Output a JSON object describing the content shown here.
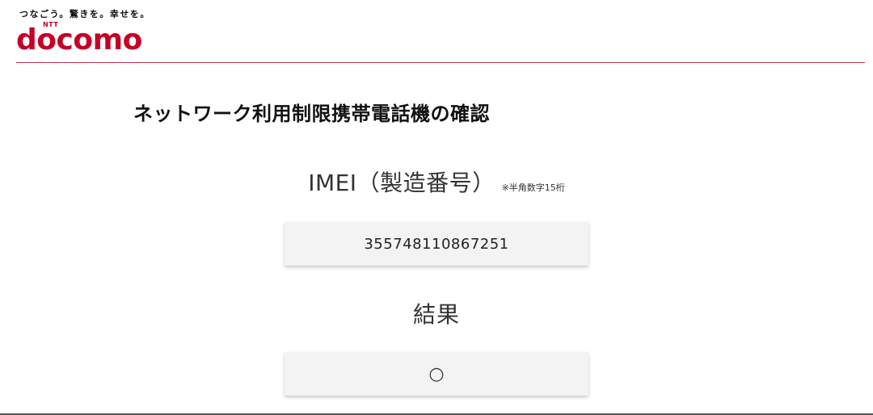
{
  "header": {
    "tagline": "つなごう。驚きを。幸せを。",
    "logo_small": "NTT",
    "logo_word": "docomo"
  },
  "page": {
    "title": "ネットワーク利用制限携帯電話機の確認"
  },
  "imei": {
    "label": "IMEI（製造番号）",
    "note": "※半角数字15桁",
    "value": "355748110867251"
  },
  "result": {
    "label": "結果",
    "value": "○"
  },
  "colors": {
    "brand": "#c40026",
    "header_rule": "#b5324a",
    "field_background": "#f3f3f3"
  }
}
